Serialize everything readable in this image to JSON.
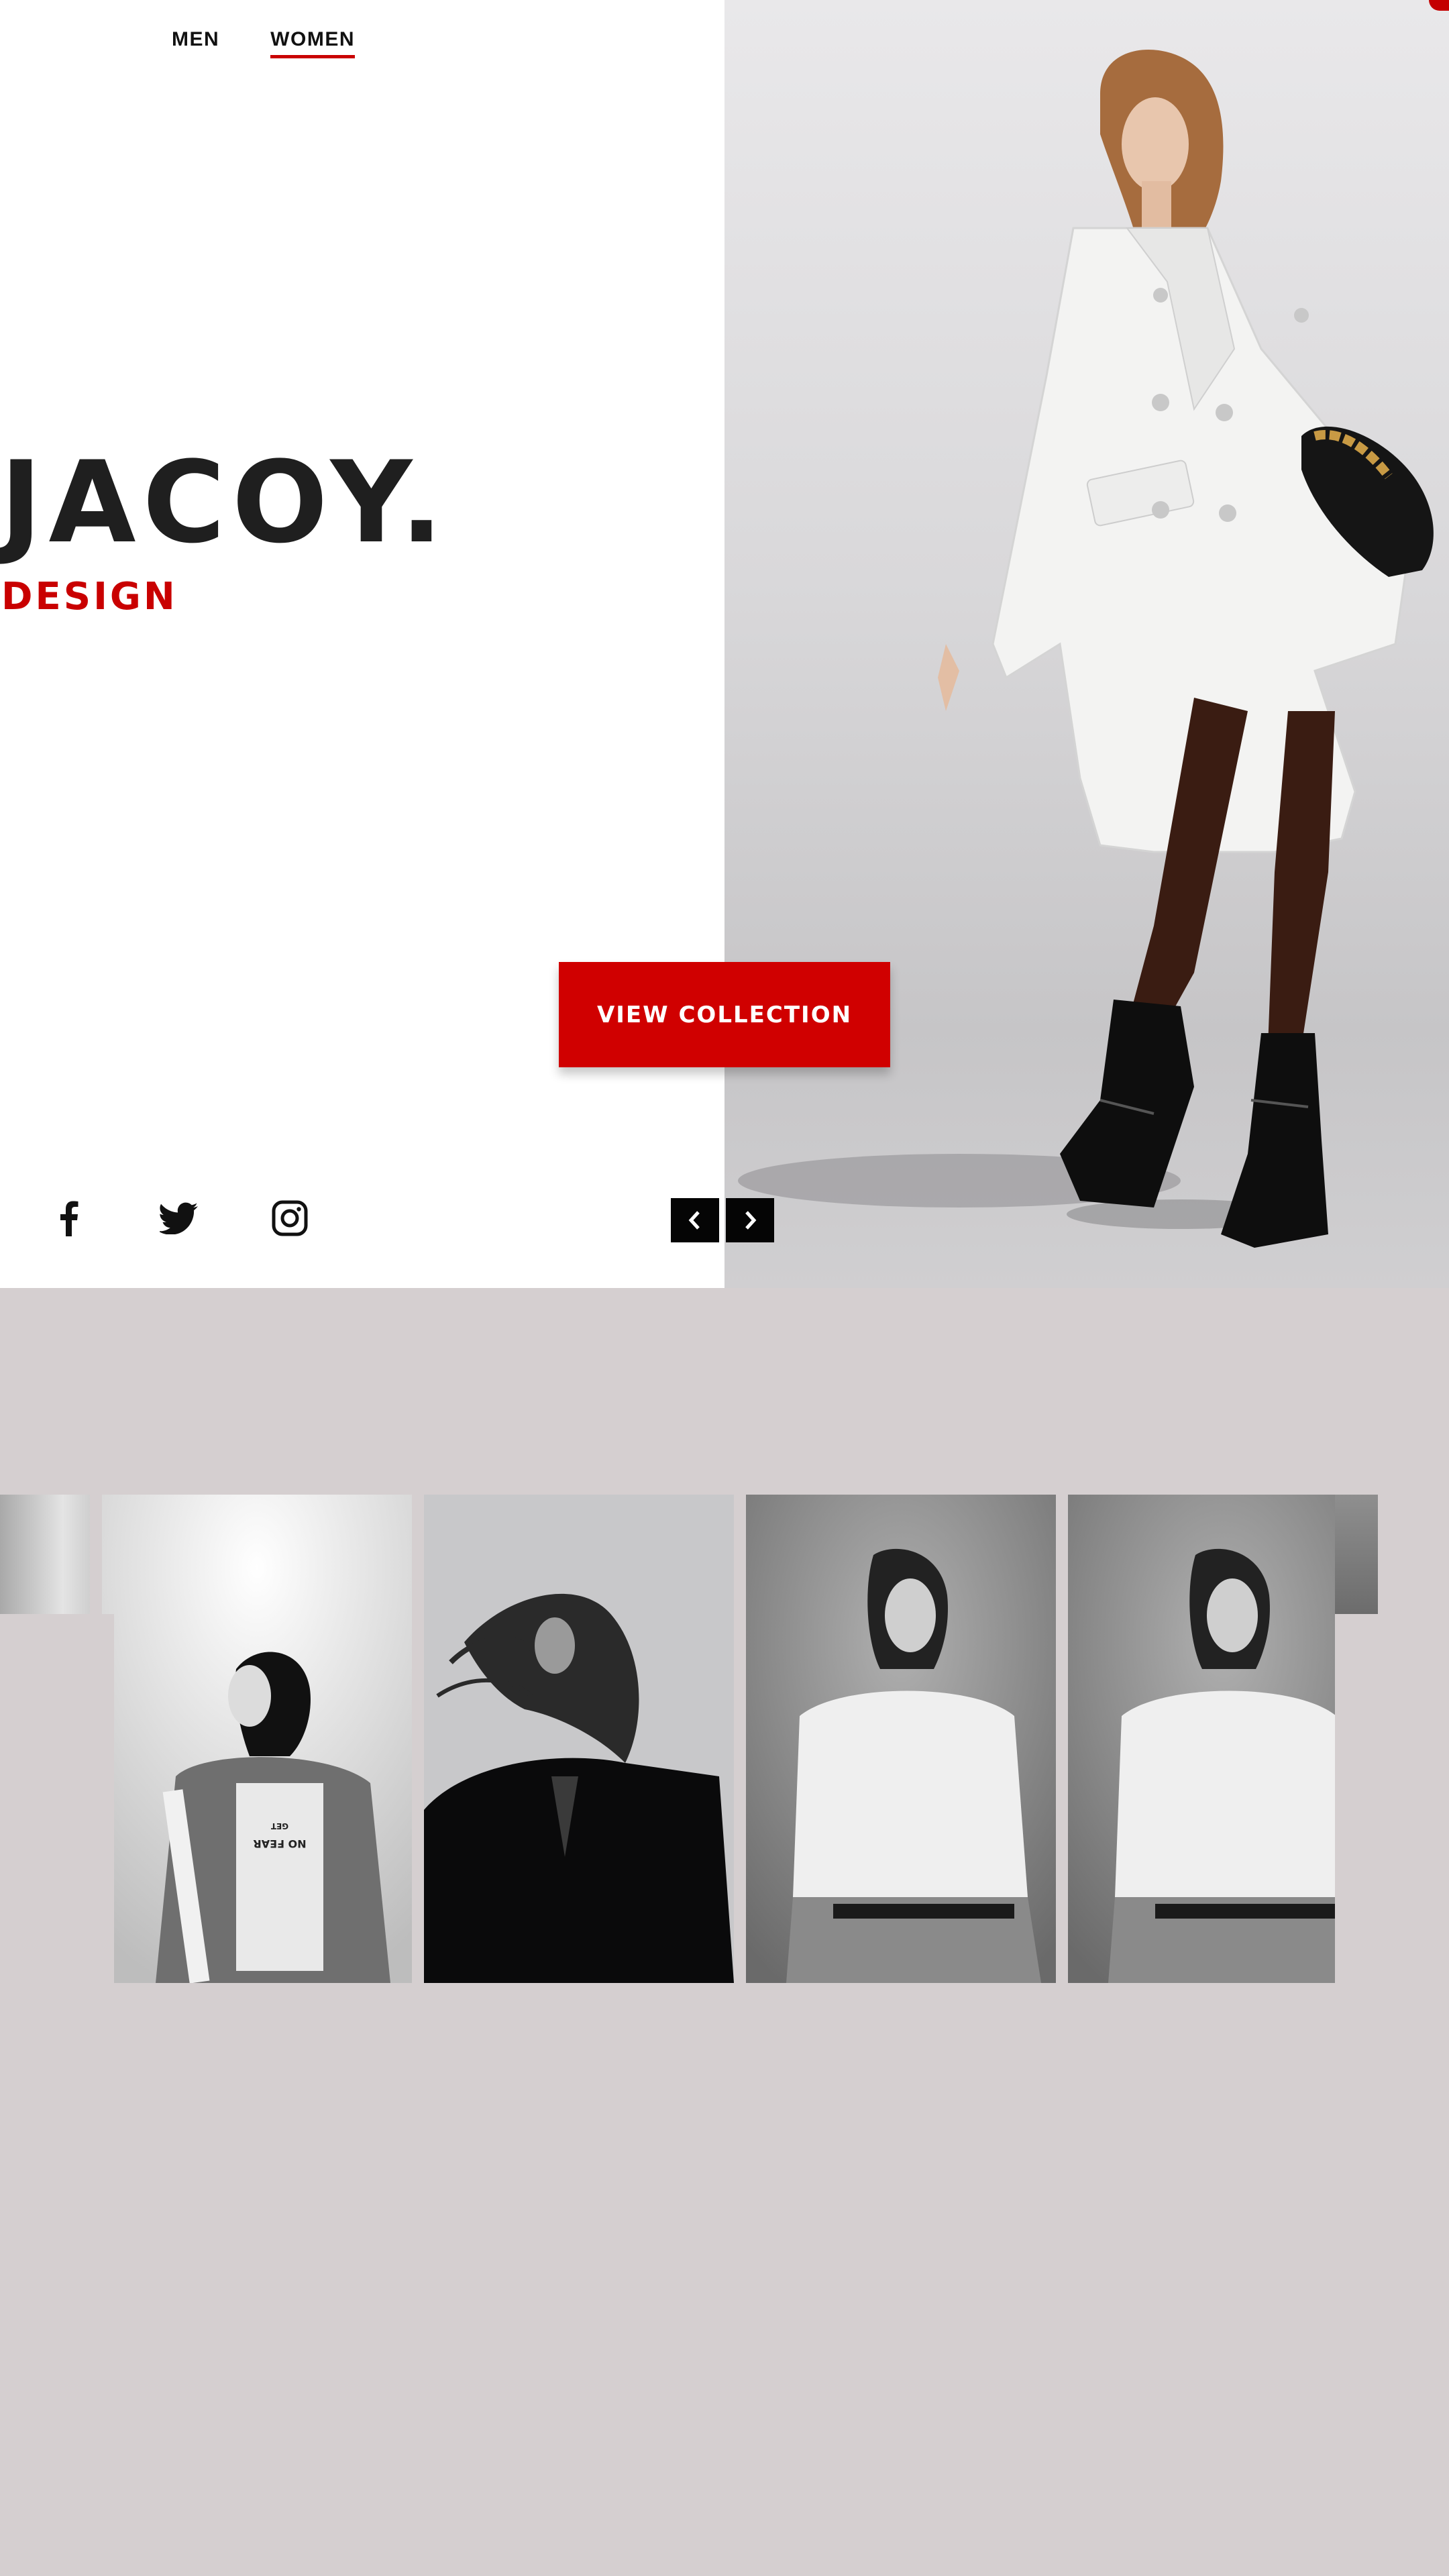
{
  "nav": {
    "items": [
      {
        "label": "MEN",
        "active": false
      },
      {
        "label": "WOMEN",
        "active": true
      }
    ]
  },
  "brand": {
    "title": "JACOY.",
    "subtitle": "DESIGN"
  },
  "hero": {
    "cta_label": "VIEW COLLECTION",
    "image": "model-white-coat-black-boots"
  },
  "social": {
    "icons": [
      "facebook-icon",
      "twitter-icon",
      "instagram-icon"
    ]
  },
  "slider": {
    "prev_icon": "chevron-left-icon",
    "next_icon": "chevron-right-icon"
  },
  "gallery": {
    "images": [
      "gray-gradient-partial",
      "woman-denim-jacket-back-view",
      "woman-hair-blowing-black-shirt",
      "woman-white-shirt-pose",
      "woman-white-shirt-pose"
    ],
    "card_text": {
      "line1": "NO FEAR",
      "line2": "GET"
    }
  },
  "colors": {
    "accent": "#c90000",
    "text_dark": "#1f1f1f",
    "page_bg": "#d5cfd0",
    "hero_bg": "#ffffff",
    "arrow_bg": "#050505"
  }
}
